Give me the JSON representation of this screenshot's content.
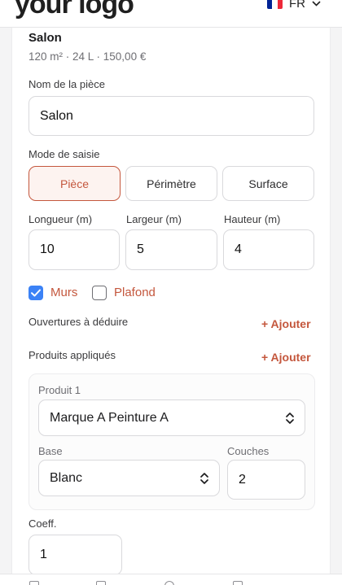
{
  "header": {
    "logo": "your logo",
    "logo_mark": "®",
    "language": "FR"
  },
  "room": {
    "title": "Salon",
    "meta": "120 m² · 24 L · 150,00 €"
  },
  "room_name": {
    "label": "Nom de la pièce",
    "value": "Salon"
  },
  "entry_mode": {
    "label": "Mode de saisie",
    "options": [
      "Pièce",
      "Périmètre",
      "Surface"
    ],
    "selected": "Pièce"
  },
  "dimensions": {
    "length_label": "Longueur (m)",
    "length_value": "10",
    "width_label": "Largeur (m)",
    "width_value": "5",
    "height_label": "Hauteur (m)",
    "height_value": "4"
  },
  "surfaces": {
    "walls_label": "Murs",
    "walls_checked": true,
    "ceiling_label": "Plafond",
    "ceiling_checked": false
  },
  "openings": {
    "label": "Ouvertures à déduire",
    "add_label": "+ Ajouter"
  },
  "products": {
    "label": "Produits appliqués",
    "add_label": "+ Ajouter",
    "items": [
      {
        "title": "Produit 1",
        "product_value": "Marque A Peinture A",
        "base_label": "Base",
        "base_value": "Blanc",
        "coats_label": "Couches",
        "coats_value": "2"
      }
    ]
  },
  "coefficient": {
    "label": "Coeff.",
    "value": "1"
  },
  "colors": {
    "accent": "#c4573d",
    "checkbox": "#3b82f6",
    "flag_blue": "#002395",
    "flag_white": "#ffffff",
    "flag_red": "#ed2939"
  }
}
